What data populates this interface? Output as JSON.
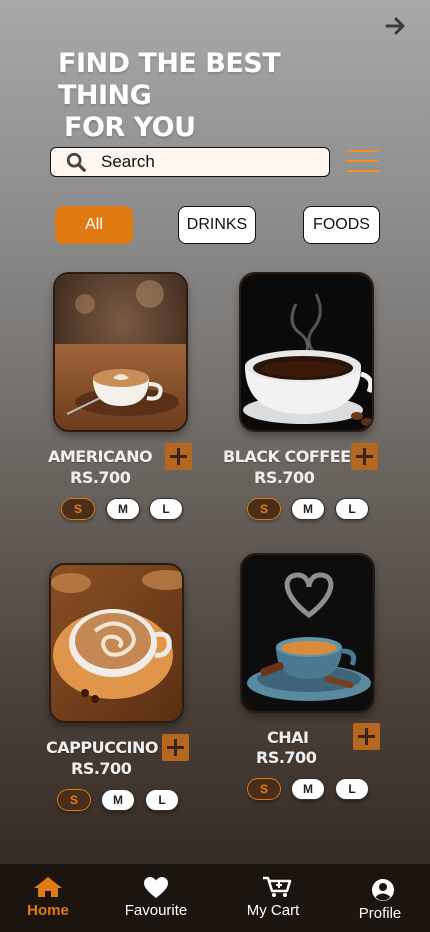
{
  "header": {
    "headline_line1": "FIND THE BEST THING",
    "headline_line2": "FOR YOU",
    "next_icon": "arrow-right-icon"
  },
  "search": {
    "placeholder": "Search",
    "icon": "search-icon"
  },
  "menu_icon": "hamburger-menu-icon",
  "filters": [
    {
      "label": "All",
      "selected": true
    },
    {
      "label": "DRINKS",
      "selected": false
    },
    {
      "label": "FOODS",
      "selected": false
    }
  ],
  "products": [
    {
      "name": "AMERICANO",
      "price": "RS.700",
      "sizes": [
        "S",
        "M",
        "L"
      ],
      "selected_size": "S"
    },
    {
      "name": "BLACK COFFEE",
      "price": "RS.700",
      "sizes": [
        "S",
        "M",
        "L"
      ],
      "selected_size": "S"
    },
    {
      "name": "CAPPUCCINO",
      "price": "RS.700",
      "sizes": [
        "S",
        "M",
        "L"
      ],
      "selected_size": "S"
    },
    {
      "name": "CHAI",
      "price": "RS.700",
      "sizes": [
        "S",
        "M",
        "L"
      ],
      "selected_size": "S"
    }
  ],
  "bottom_nav": [
    {
      "label": "Home",
      "icon": "home-icon",
      "active": true
    },
    {
      "label": "Favourite",
      "icon": "heart-icon",
      "active": false
    },
    {
      "label": "My Cart",
      "icon": "cart-icon",
      "active": false
    },
    {
      "label": "Profile",
      "icon": "profile-icon",
      "active": false
    }
  ],
  "colors": {
    "accent": "#e07a12",
    "nav_background": "#1c140e",
    "add_button": "#b5661f"
  }
}
